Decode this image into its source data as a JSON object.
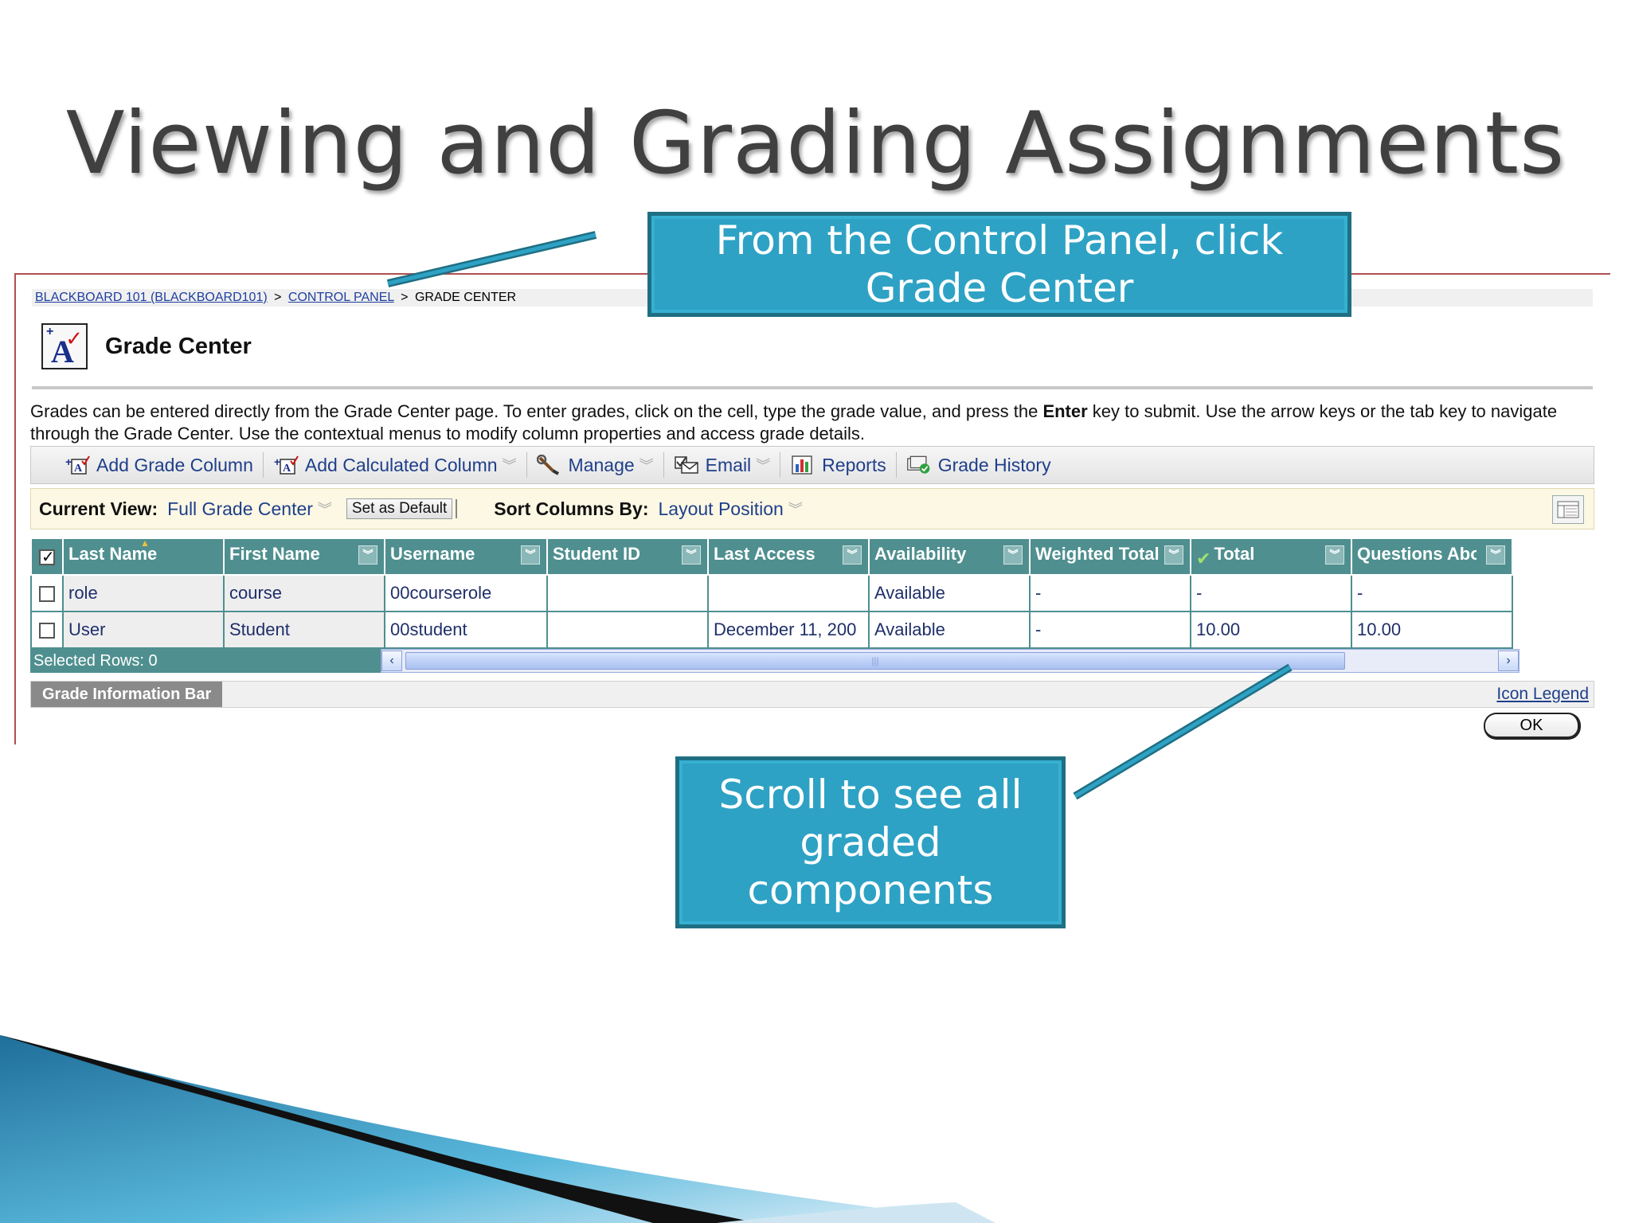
{
  "slide": {
    "title": "Viewing and Grading Assignments"
  },
  "callouts": {
    "top": "From the Control Panel, click Grade Center",
    "bottom": "Scroll to see all graded components"
  },
  "breadcrumb": {
    "course": "BLACKBOARD 101 (BLACKBOARD101)",
    "sep1": ">",
    "control_panel": "CONTROL PANEL",
    "sep2": ">",
    "current": "GRADE CENTER"
  },
  "page": {
    "title": "Grade Center",
    "instructions_part1": "Grades can be entered directly from the Grade Center page. To enter grades, click on the cell, type the grade value, and press the ",
    "instructions_bold": "Enter",
    "instructions_part2": " key to submit. Use the arrow keys or the tab key to navigate through the Grade Center. Use the contextual menus to modify column properties and access grade details."
  },
  "toolbar": {
    "add_grade_column": "Add Grade Column",
    "add_calculated_column": "Add Calculated Column",
    "manage": "Manage",
    "email": "Email",
    "reports": "Reports",
    "grade_history": "Grade History"
  },
  "viewbar": {
    "current_view_label": "Current View:",
    "current_view_value": "Full Grade Center",
    "set_as_default": "Set as Default",
    "sort_label": "Sort Columns By:",
    "sort_value": "Layout Position"
  },
  "grid": {
    "headers": {
      "last_name": "Last Name",
      "first_name": "First Name",
      "username": "Username",
      "student_id": "Student ID",
      "last_access": "Last Access",
      "availability": "Availability",
      "weighted_total": "Weighted Total",
      "total": "Total",
      "questions": "Questions Abo"
    },
    "rows": [
      {
        "last_name": "role",
        "first_name": "course",
        "username": "00courserole",
        "student_id": "",
        "last_access": "",
        "availability": "Available",
        "weighted_total": "-",
        "total": "-",
        "questions": "-"
      },
      {
        "last_name": "User",
        "first_name": "Student",
        "username": "00student",
        "student_id": "",
        "last_access": "December 11, 200",
        "availability": "Available",
        "weighted_total": "-",
        "total": "10.00",
        "questions": "10.00"
      }
    ],
    "selected_rows": "Selected Rows: 0"
  },
  "info_bar": {
    "tab": "Grade Information Bar",
    "icon_legend": "Icon Legend",
    "ok": "OK"
  },
  "colors": {
    "callout_fill": "#2ea2c4",
    "callout_border": "#1f6f83",
    "grid_header": "#4f8f8f",
    "link": "#1f3f8a"
  }
}
